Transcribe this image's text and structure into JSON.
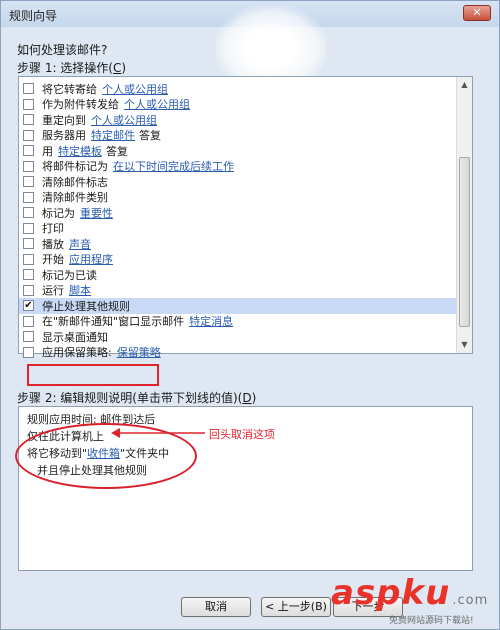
{
  "window": {
    "title": "规则向导",
    "close_icon": "close-icon"
  },
  "question": "如何处理该邮件?",
  "step1": {
    "text": "步骤 1: 选择操作(",
    "key": "C",
    "close": ")"
  },
  "actions": [
    {
      "label": "将它转寄给",
      "link": "个人或公用组",
      "suffix": "",
      "checked": false
    },
    {
      "label": "作为附件转发给",
      "link": "个人或公用组",
      "suffix": "",
      "checked": false
    },
    {
      "label": "重定向到",
      "link": "个人或公用组",
      "suffix": "",
      "checked": false
    },
    {
      "label": "服务器用",
      "link": "特定邮件",
      "suffix": "答复",
      "checked": false
    },
    {
      "label": "用",
      "link": "特定模板",
      "suffix": "答复",
      "checked": false
    },
    {
      "label": "将邮件标记为",
      "link": "在以下时间完成后续工作",
      "suffix": "",
      "checked": false
    },
    {
      "label": "清除邮件标志",
      "link": "",
      "suffix": "",
      "checked": false
    },
    {
      "label": "清除邮件类别",
      "link": "",
      "suffix": "",
      "checked": false
    },
    {
      "label": "标记为",
      "link": "重要性",
      "suffix": "",
      "checked": false
    },
    {
      "label": "打印",
      "link": "",
      "suffix": "",
      "checked": false
    },
    {
      "label": "播放",
      "link": "声音",
      "suffix": "",
      "checked": false
    },
    {
      "label": "开始",
      "link": "应用程序",
      "suffix": "",
      "checked": false
    },
    {
      "label": "标记为已读",
      "link": "",
      "suffix": "",
      "checked": false
    },
    {
      "label": "运行",
      "link": "脚本",
      "suffix": "",
      "checked": false
    },
    {
      "label": "停止处理其他规则",
      "link": "",
      "suffix": "",
      "checked": true
    },
    {
      "label": "在\"新邮件通知\"窗口显示邮件",
      "link": "特定消息",
      "suffix": "",
      "checked": false
    },
    {
      "label": "显示桌面通知",
      "link": "",
      "suffix": "",
      "checked": false
    },
    {
      "label": "应用保留策略:",
      "link": "保留策略",
      "suffix": "",
      "checked": false
    }
  ],
  "step2": {
    "text": "步骤 2: 编辑规则说明(单击带下划线的值)(",
    "key": "D",
    "close": ")"
  },
  "description": {
    "line1": "规则应用时间: 邮件到达后",
    "line2": "仅在此计算机上",
    "line3_prefix": "将它移动到\"",
    "line3_link": "收件箱",
    "line3_suffix": "\"文件夹中",
    "line4": "并且停止处理其他规则"
  },
  "annotation": "回头取消这项",
  "buttons": {
    "cancel": "取消",
    "back": "< 上一步(B)",
    "next": "下一步"
  },
  "watermark": {
    "brand": "aspku",
    "tld": ".com",
    "tagline": "免费网站源码下载站!"
  },
  "colors": {
    "highlight_red": "#e0242f",
    "link_blue": "#2a5db0",
    "selection": "#c8daf6"
  }
}
